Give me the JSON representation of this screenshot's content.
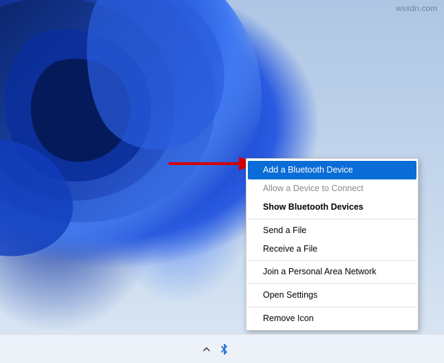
{
  "watermark": "wsxdn.com",
  "context_menu": {
    "items": [
      {
        "label": "Add a Bluetooth Device",
        "highlighted": true
      },
      {
        "label": "Allow a Device to Connect",
        "disabled": true
      },
      {
        "label": "Show Bluetooth Devices",
        "bold": true
      },
      {
        "label": "Send a File"
      },
      {
        "label": "Receive a File"
      },
      {
        "label": "Join a Personal Area Network"
      },
      {
        "label": "Open Settings"
      },
      {
        "label": "Remove Icon"
      }
    ]
  },
  "tray": {
    "chevron_title": "Show hidden icons",
    "bluetooth_title": "Bluetooth Devices"
  },
  "colors": {
    "highlight": "#0a6cd6",
    "arrow": "#d40000"
  }
}
